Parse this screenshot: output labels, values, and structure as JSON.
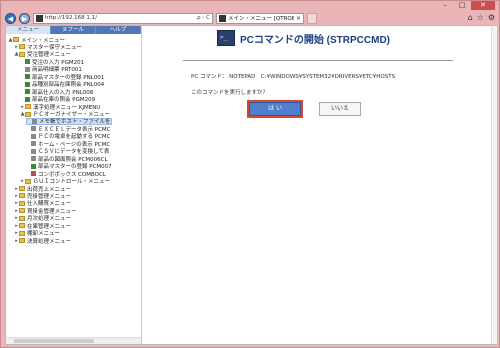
{
  "browser": {
    "url": "http://192.168.1.1/",
    "tab_title": "メイン・メニュー [QTROBJ /M...",
    "addr_controls": "ρ - C",
    "nav_right_icons": [
      "home-icon",
      "star-icon",
      "gear-icon"
    ]
  },
  "menu_tabs": [
    "メニュー",
    "ヌフール",
    "ヘルプ"
  ],
  "tree": [
    {
      "text": "メイン・メニュー",
      "depth": 0,
      "icon": "folder",
      "expander": "▲"
    },
    {
      "text": "マスター保守メニュー",
      "depth": 1,
      "icon": "folder",
      "expander": "▸"
    },
    {
      "text": "受注管理メニュー",
      "depth": 1,
      "icon": "folder",
      "expander": "▲"
    },
    {
      "text": "受注の入力 PGM201",
      "depth": 2,
      "icon": "prog"
    },
    {
      "text": "商品明細票 PRT001",
      "depth": 2,
      "icon": "prog-gray"
    },
    {
      "text": "部品マスターの登録 PNL001",
      "depth": 2,
      "icon": "prog"
    },
    {
      "text": "品種別部品在庫照会 PNL004",
      "depth": 2,
      "icon": "prog"
    },
    {
      "text": "部品仕入の入力 PNL008",
      "depth": 2,
      "icon": "prog"
    },
    {
      "text": "部品在庫の照会 PGM209",
      "depth": 2,
      "icon": "prog"
    },
    {
      "text": "漢字処理メニュー KJMENU",
      "depth": 2,
      "icon": "folder",
      "expander": "▸"
    },
    {
      "text": "ＰＣオーガナイザー・メニュー",
      "depth": 2,
      "icon": "folder",
      "expander": "▲"
    },
    {
      "text": "メモ帳でホスト・ファイルを",
      "depth": 3,
      "icon": "prog-gray",
      "selected": true
    },
    {
      "text": "ＥＸＣＥＬデータ表示 PCMC",
      "depth": 3,
      "icon": "prog-gray"
    },
    {
      "text": "ＰＣの電卓を起動する PCMC",
      "depth": 3,
      "icon": "prog-gray"
    },
    {
      "text": "ホーム・ページの表示 PCMC",
      "depth": 3,
      "icon": "prog-gray"
    },
    {
      "text": "ＣＳＶにデータを変換して表",
      "depth": 3,
      "icon": "prog-gray"
    },
    {
      "text": "部品の図面照会 PCM006CL",
      "depth": 3,
      "icon": "prog-gray"
    },
    {
      "text": "部品マスターの登録 PCM007",
      "depth": 3,
      "icon": "prog"
    },
    {
      "text": "コンボボックス COMBOCL",
      "depth": 3,
      "icon": "prog-red"
    },
    {
      "text": "ＧＵＩコントロール・メニュー",
      "depth": 2,
      "icon": "folder",
      "expander": "▸"
    },
    {
      "text": "出荷売上メニュー",
      "depth": 1,
      "icon": "folder",
      "expander": "▸"
    },
    {
      "text": "売掛管理メニュー",
      "depth": 1,
      "icon": "folder",
      "expander": "▸"
    },
    {
      "text": "仕入購買メニュー",
      "depth": 1,
      "icon": "folder",
      "expander": "▸"
    },
    {
      "text": "買掛金管理メニュー",
      "depth": 1,
      "icon": "folder",
      "expander": "▸"
    },
    {
      "text": "月次処理メニュー",
      "depth": 1,
      "icon": "folder",
      "expander": "▸"
    },
    {
      "text": "在庫管理メニュー",
      "depth": 1,
      "icon": "folder",
      "expander": "▸"
    },
    {
      "text": "棚卸メニュー",
      "depth": 1,
      "icon": "folder",
      "expander": "▸"
    },
    {
      "text": "決算処理メニュー",
      "depth": 1,
      "icon": "folder",
      "expander": "▸"
    }
  ],
  "main": {
    "title": "PCコマンドの開始 (STRPCCMD)",
    "command": "PC コマンド： NOTEPAD　C:¥WINDOWS¥SYSTEM32¥DRIVERS¥ETC¥HOSTS",
    "question": "このコマンドを実行しますか？",
    "yes_label": "は い",
    "no_label": "いいえ"
  },
  "colors": {
    "accent": "#4f7fcc",
    "focus_ring": "#d9472f",
    "title_text": "#1d3f86",
    "window_frame": "#e9b5b7"
  }
}
